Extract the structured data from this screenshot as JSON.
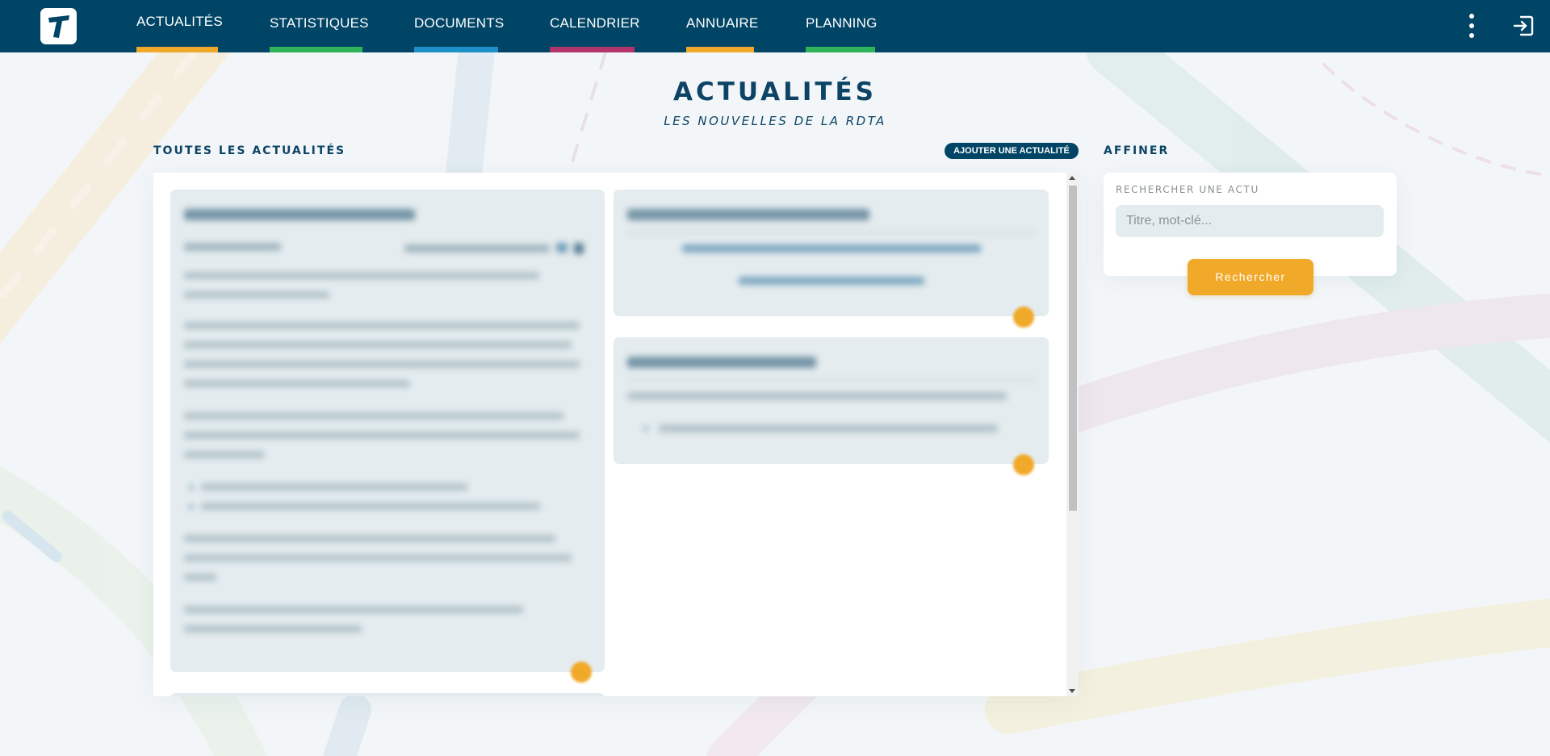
{
  "nav": {
    "items": [
      {
        "label": "ACTUALITÉS",
        "color": "#f1a92a",
        "active": true
      },
      {
        "label": "STATISTIQUES",
        "color": "#2eb35a"
      },
      {
        "label": "DOCUMENTS",
        "color": "#1e90c8"
      },
      {
        "label": "CALENDRIER",
        "color": "#b3336b"
      },
      {
        "label": "ANNUAIRE",
        "color": "#f1a92a"
      },
      {
        "label": "PLANNING",
        "color": "#2eb35a"
      }
    ]
  },
  "header": {
    "title": "ACTUALITÉS",
    "subtitle": "LES NOUVELLES DE LA RDTA"
  },
  "news": {
    "section_title": "TOUTES LES ACTUALITÉS",
    "add_button": "AJOUTER UNE ACTUALITÉ"
  },
  "filter": {
    "section_title": "AFFINER",
    "search_label": "RECHERCHER UNE ACTU",
    "search_placeholder": "Titre, mot-clé...",
    "search_value": "",
    "search_button": "Rechercher"
  },
  "colors": {
    "primary": "#004466",
    "accent": "#f1a92a",
    "card": "#e4ecef"
  }
}
